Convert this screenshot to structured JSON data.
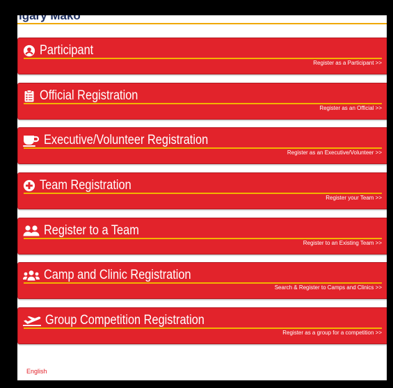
{
  "header": {
    "org_name": "lgary Mako"
  },
  "cards": [
    {
      "title": "Participant",
      "link": "Register as a Participant >>",
      "icon": "user-circle-icon"
    },
    {
      "title": "Official Registration",
      "link": "Register as an Official >>",
      "icon": "clipboard-list-icon"
    },
    {
      "title": "Executive/Volunteer Registration",
      "link": "Register as an Executive/Volunteer >>",
      "icon": "coffee-cup-icon"
    },
    {
      "title": "Team Registration",
      "link": "Register your Team >>",
      "icon": "plus-circle-icon"
    },
    {
      "title": "Register to a Team",
      "link": "Register to an Existing Team >>",
      "icon": "users-icon"
    },
    {
      "title": "Camp and Clinic Registration",
      "link": "Search & Register to Camps and Clinics >>",
      "icon": "users-group-icon"
    },
    {
      "title": "Group Competition Registration",
      "link": "Register as a group for a competition >>",
      "icon": "plane-departure-icon"
    }
  ],
  "footer": {
    "language": "English"
  },
  "colors": {
    "card_bg": "#e2232b",
    "accent_line": "#f2b400",
    "heading": "#1c2c5c"
  }
}
